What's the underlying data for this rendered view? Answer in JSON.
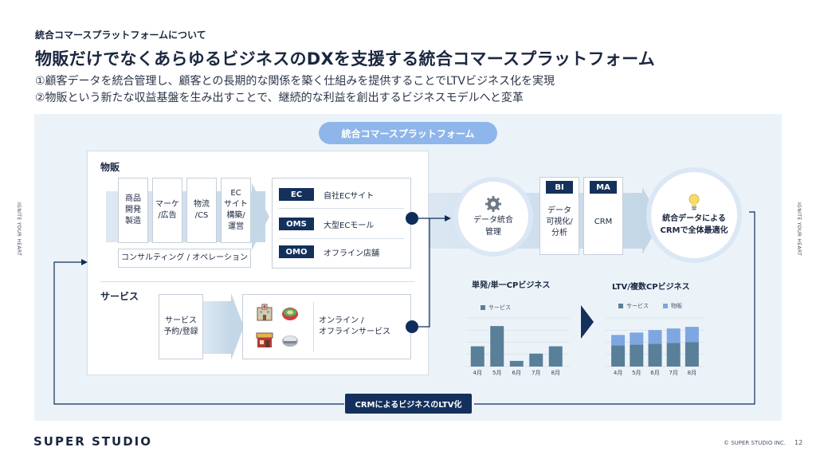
{
  "header": {
    "kicker": "統合コマースプラットフォームについて",
    "title": "物販だけでなくあらゆるビジネスのDXを支援する統合コマースプラットフォーム",
    "sub1": "①顧客データを統合管理し、顧客との長期的な関係を築く仕組みを提供することでLTVビジネス化を実現",
    "sub2": "②物販という新たな収益基盤を生み出すことで、継続的な利益を創出するビジネスモデルへと変革"
  },
  "side_text": "IGNITE YOUR HEART",
  "diagram": {
    "platform_label": "統合コマースプラットフォーム",
    "buppan": {
      "label": "物販",
      "steps": [
        "商品\n開発\n製造",
        "マーケ\n/広告",
        "物流\n/CS",
        "EC\nサイト\n構築/\n運営"
      ],
      "consulting": "コンサルティング / オペレーション",
      "channels": [
        {
          "badge": "EC",
          "text": "自社ECサイト"
        },
        {
          "badge": "OMS",
          "text": "大型ECモール"
        },
        {
          "badge": "OMO",
          "text": "オフライン店舗"
        }
      ]
    },
    "service": {
      "label": "サービス",
      "step": "サービス\n予約/登録",
      "online": "オンライン /\nオフラインサービス",
      "icons": [
        "hospital-icon",
        "stadium-icon",
        "shop-icon",
        "dome-icon"
      ]
    },
    "data_integration": {
      "icon": "gear-icon",
      "text": "データ統合\n管理"
    },
    "bi": {
      "tag": "BI",
      "text": "データ\n可視化/\n分析"
    },
    "ma": {
      "tag": "MA",
      "text": "CRM"
    },
    "goal": {
      "icon": "lightbulb-icon",
      "text": "統合データによる\nCRMで全体最適化"
    },
    "crm_ltv": "CRMによるビジネスのLTV化"
  },
  "chart_data": [
    {
      "type": "bar",
      "title": "単発/単一CPビジネス",
      "categories": [
        "4月",
        "5月",
        "6月",
        "7月",
        "8月"
      ],
      "series": [
        {
          "name": "サービス",
          "values": [
            2.5,
            5.0,
            0.7,
            1.6,
            2.5
          ]
        }
      ],
      "ylim": [
        0,
        6
      ],
      "grid": true,
      "colors": {
        "サービス": "#5a7f98"
      }
    },
    {
      "type": "bar",
      "stacked": true,
      "title": "LTV/複数CPビジネス",
      "categories": [
        "4月",
        "5月",
        "6月",
        "7月",
        "8月"
      ],
      "series": [
        {
          "name": "サービス",
          "values": [
            2.6,
            2.7,
            2.8,
            2.9,
            3.0
          ]
        },
        {
          "name": "物販",
          "values": [
            1.3,
            1.5,
            1.7,
            1.8,
            1.9
          ]
        }
      ],
      "ylim": [
        0,
        6
      ],
      "grid": true,
      "colors": {
        "サービス": "#5a7f98",
        "物販": "#7ea6e0"
      }
    }
  ],
  "footer": {
    "logo": "SUPER STUDIO",
    "copyright": "© SUPER STUDIO INC.",
    "page": "12"
  }
}
